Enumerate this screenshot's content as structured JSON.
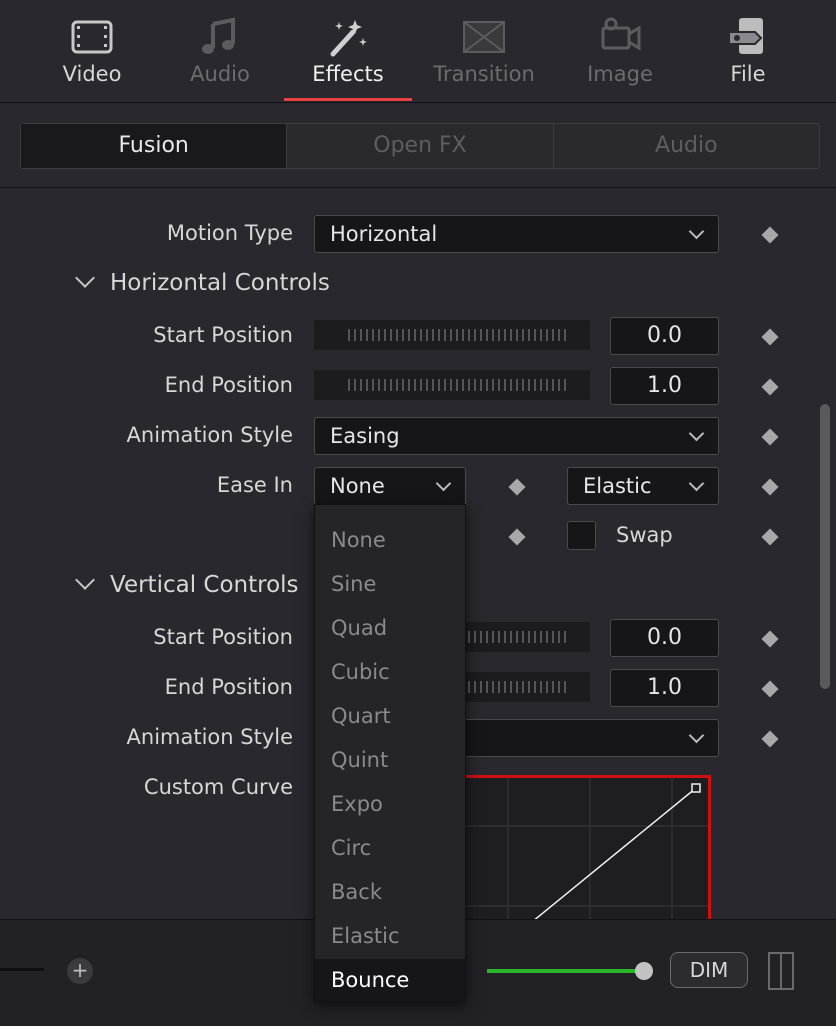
{
  "top_tabs": [
    {
      "label": "Video",
      "icon": "film-strip-icon",
      "state": "normal"
    },
    {
      "label": "Audio",
      "icon": "music-note-icon",
      "state": "disabled"
    },
    {
      "label": "Effects",
      "icon": "magic-wand-icon",
      "state": "active"
    },
    {
      "label": "Transition",
      "icon": "transition-icon",
      "state": "disabled"
    },
    {
      "label": "Image",
      "icon": "camera-icon",
      "state": "disabled"
    },
    {
      "label": "File",
      "icon": "file-tag-icon",
      "state": "normal"
    }
  ],
  "segmented": [
    "Fusion",
    "Open FX",
    "Audio"
  ],
  "motion_type": {
    "label": "Motion Type",
    "value": "Horizontal"
  },
  "horizontal": {
    "title": "Horizontal Controls",
    "start_label": "Start Position",
    "start_value": "0.0",
    "end_label": "End Position",
    "end_value": "1.0",
    "anim_label": "Animation Style",
    "anim_value": "Easing",
    "ease_in_label": "Ease In",
    "ease_in_value": "None",
    "ease_type_value": "Elastic",
    "swap_label": "Swap"
  },
  "vertical": {
    "title": "Vertical Controls",
    "start_label": "Start Position",
    "start_value": "0.0",
    "end_label": "End Position",
    "end_value": "1.0",
    "anim_label": "Animation Style",
    "curve_label": "Custom Curve"
  },
  "dropdown": {
    "options": [
      "None",
      "Sine",
      "Quad",
      "Cubic",
      "Quart",
      "Quint",
      "Expo",
      "Circ",
      "Back",
      "Elastic",
      "Bounce"
    ],
    "highlighted": "Bounce"
  },
  "bottom": {
    "dim_label": "DIM",
    "plus_label": "+"
  },
  "colors": {
    "accent": "#e84040",
    "curve_border": "#d01010",
    "meter": "#2bb52b"
  }
}
